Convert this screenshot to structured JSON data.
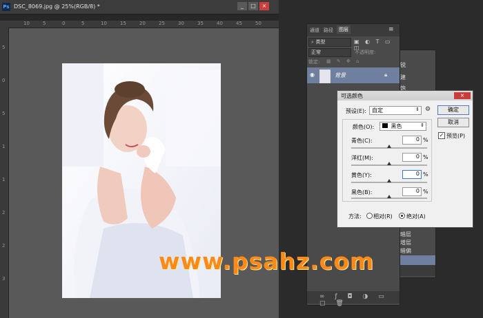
{
  "document": {
    "title": "DSC_8069.jpg @ 25%(RGB/8) *",
    "ps_logo": "Ps",
    "ruler_top_ticks": [
      "10",
      "5",
      "0",
      "5",
      "10",
      "15",
      "20",
      "25",
      "30",
      "35",
      "40",
      "45",
      "50"
    ],
    "ruler_left_ticks": [
      "5",
      "0",
      "5",
      "1",
      "1",
      "2",
      "2",
      "3"
    ]
  },
  "layers_panel": {
    "tabs": [
      "通道",
      "路径",
      "图层"
    ],
    "search_label": "类型",
    "blend_mode": "正常",
    "opacity_label": "不透明度:",
    "lock_label": "锁定:",
    "layer_name": "背景"
  },
  "back_panel": {
    "items": [
      "锐",
      "建",
      "饱",
      "描",
      "增",
      "减",
      "历"
    ],
    "lower_items": [
      "暗层",
      "增层",
      "暗偏",
      "蓝"
    ]
  },
  "dialog": {
    "title": "可选颜色",
    "preset_label": "预设(E):",
    "preset_value": "自定",
    "ok_label": "确定",
    "cancel_label": "取消",
    "preview_label": "预览(P)",
    "colors_label": "颜色(O):",
    "colors_value": "黑色",
    "sliders": [
      {
        "label": "青色(C):",
        "value": "0",
        "unit": "%"
      },
      {
        "label": "洋红(M):",
        "value": "0",
        "unit": "%"
      },
      {
        "label": "黄色(Y):",
        "value": "0",
        "unit": "%"
      },
      {
        "label": "黑色(B):",
        "value": "0",
        "unit": "%"
      }
    ],
    "method_label": "方法:",
    "relative_label": "相对(R)",
    "absolute_label": "绝对(A)"
  },
  "watermark": "www.psahz.com"
}
